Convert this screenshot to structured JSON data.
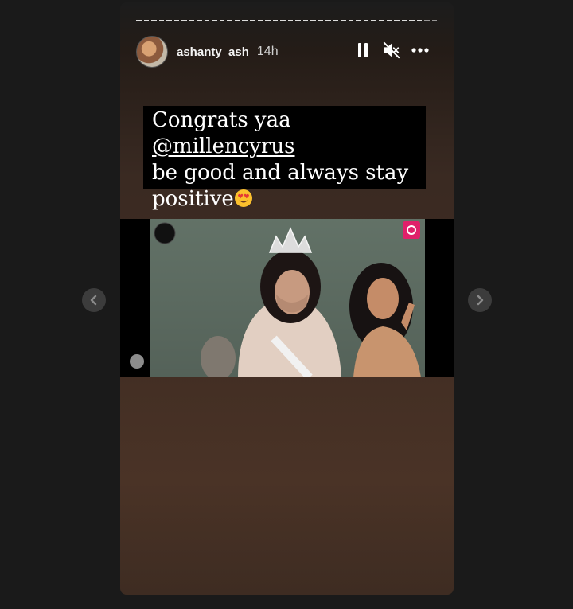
{
  "story": {
    "progress_segments": 40,
    "seen_segments": 38,
    "header": {
      "username": "ashanty_ash",
      "time_ago": "14h",
      "icons": [
        "pause-icon",
        "muted-speaker-icon",
        "more-options-icon"
      ]
    },
    "caption": {
      "line1_prefix": "Congrats yaa ",
      "mention": "@millencyrus",
      "line2": "be good and always stay",
      "line3": "positive",
      "emoji": "heart-eyes-emoji"
    },
    "video": {
      "logo_icon": "channel-logo-icon",
      "badge_icon": "channel-badge-icon"
    }
  },
  "navigation": {
    "prev_icon": "chevron-left-icon",
    "next_icon": "chevron-right-icon"
  },
  "colors": {
    "page_background": "#1a1a1a",
    "story_bottom": "#4a3326",
    "caption_background": "#000000",
    "text": "#ffffff",
    "badge": "#e0206a"
  }
}
